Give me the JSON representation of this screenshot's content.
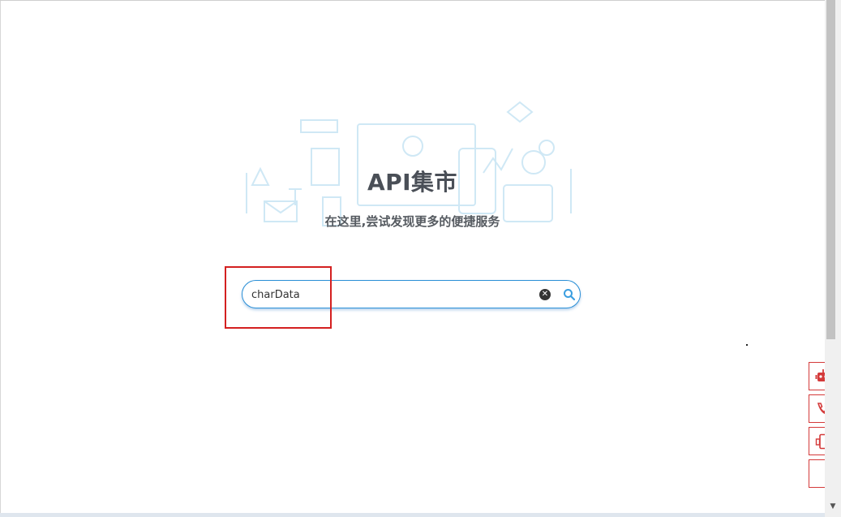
{
  "hero": {
    "title": "API集市",
    "subtitle": "在这里,尝试发现更多的便捷服务"
  },
  "search": {
    "value": "charData",
    "clear_icon": "clear-icon",
    "search_icon": "search-icon"
  },
  "side_toolbar": [
    {
      "icon": "robot-icon"
    },
    {
      "icon": "phone-icon"
    },
    {
      "icon": "mobile-device-icon"
    },
    {
      "icon": "empty"
    }
  ],
  "colors": {
    "accent": "#2a8fd6",
    "side_border": "#d43a3a",
    "highlight": "#d42020",
    "title": "#4a4f57"
  }
}
